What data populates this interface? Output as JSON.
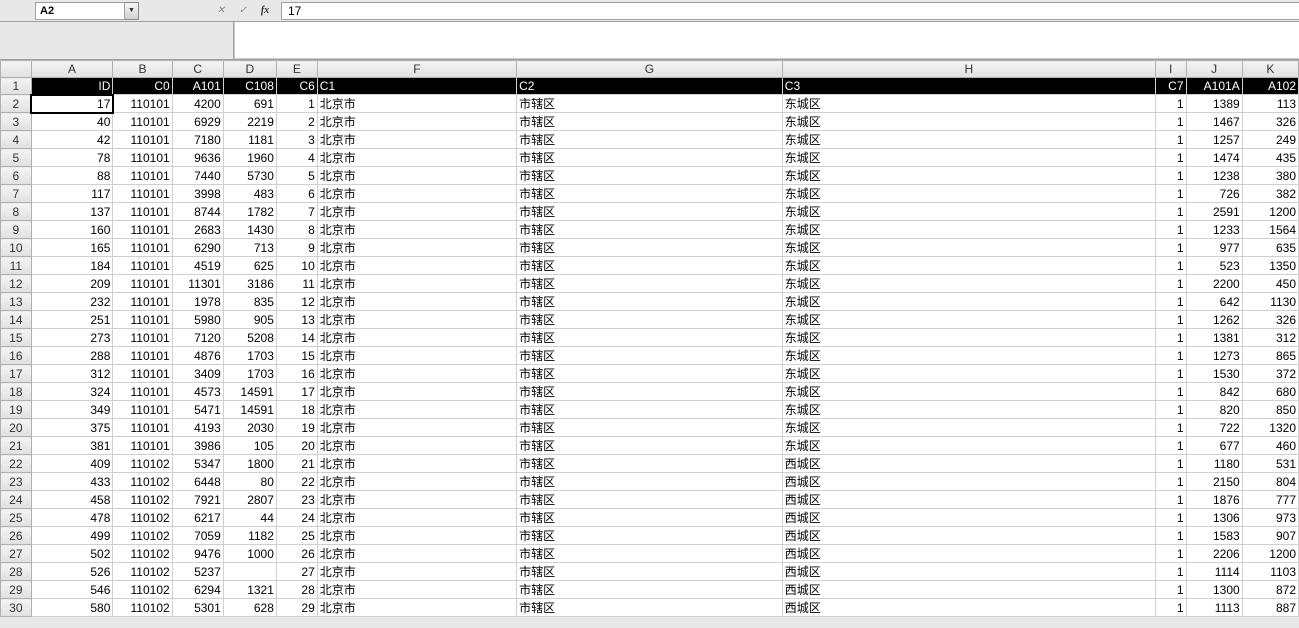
{
  "nameBox": "A2",
  "formula": "17",
  "columns": [
    "A",
    "B",
    "C",
    "D",
    "E",
    "F",
    "G",
    "H",
    "I",
    "J",
    "K"
  ],
  "headerRow": {
    "A": "ID",
    "B": "C0",
    "C": "A101",
    "D": "C108",
    "E": "C6",
    "F": "C1",
    "G": "C2",
    "H": "C3",
    "I": "C7",
    "J": "A101A",
    "K": "A102"
  },
  "rows": [
    {
      "n": 2,
      "A": "17",
      "B": "110101",
      "C": "4200",
      "D": "691",
      "E": "1",
      "F": "北京市",
      "G": "市辖区",
      "H": "东城区",
      "I": "1",
      "J": "1389",
      "K": "113"
    },
    {
      "n": 3,
      "A": "40",
      "B": "110101",
      "C": "6929",
      "D": "2219",
      "E": "2",
      "F": "北京市",
      "G": "市辖区",
      "H": "东城区",
      "I": "1",
      "J": "1467",
      "K": "326"
    },
    {
      "n": 4,
      "A": "42",
      "B": "110101",
      "C": "7180",
      "D": "1181",
      "E": "3",
      "F": "北京市",
      "G": "市辖区",
      "H": "东城区",
      "I": "1",
      "J": "1257",
      "K": "249"
    },
    {
      "n": 5,
      "A": "78",
      "B": "110101",
      "C": "9636",
      "D": "1960",
      "E": "4",
      "F": "北京市",
      "G": "市辖区",
      "H": "东城区",
      "I": "1",
      "J": "1474",
      "K": "435"
    },
    {
      "n": 6,
      "A": "88",
      "B": "110101",
      "C": "7440",
      "D": "5730",
      "E": "5",
      "F": "北京市",
      "G": "市辖区",
      "H": "东城区",
      "I": "1",
      "J": "1238",
      "K": "380"
    },
    {
      "n": 7,
      "A": "117",
      "B": "110101",
      "C": "3998",
      "D": "483",
      "E": "6",
      "F": "北京市",
      "G": "市辖区",
      "H": "东城区",
      "I": "1",
      "J": "726",
      "K": "382"
    },
    {
      "n": 8,
      "A": "137",
      "B": "110101",
      "C": "8744",
      "D": "1782",
      "E": "7",
      "F": "北京市",
      "G": "市辖区",
      "H": "东城区",
      "I": "1",
      "J": "2591",
      "K": "1200"
    },
    {
      "n": 9,
      "A": "160",
      "B": "110101",
      "C": "2683",
      "D": "1430",
      "E": "8",
      "F": "北京市",
      "G": "市辖区",
      "H": "东城区",
      "I": "1",
      "J": "1233",
      "K": "1564"
    },
    {
      "n": 10,
      "A": "165",
      "B": "110101",
      "C": "6290",
      "D": "713",
      "E": "9",
      "F": "北京市",
      "G": "市辖区",
      "H": "东城区",
      "I": "1",
      "J": "977",
      "K": "635"
    },
    {
      "n": 11,
      "A": "184",
      "B": "110101",
      "C": "4519",
      "D": "625",
      "E": "10",
      "F": "北京市",
      "G": "市辖区",
      "H": "东城区",
      "I": "1",
      "J": "523",
      "K": "1350"
    },
    {
      "n": 12,
      "A": "209",
      "B": "110101",
      "C": "11301",
      "D": "3186",
      "E": "11",
      "F": "北京市",
      "G": "市辖区",
      "H": "东城区",
      "I": "1",
      "J": "2200",
      "K": "450"
    },
    {
      "n": 13,
      "A": "232",
      "B": "110101",
      "C": "1978",
      "D": "835",
      "E": "12",
      "F": "北京市",
      "G": "市辖区",
      "H": "东城区",
      "I": "1",
      "J": "642",
      "K": "1130"
    },
    {
      "n": 14,
      "A": "251",
      "B": "110101",
      "C": "5980",
      "D": "905",
      "E": "13",
      "F": "北京市",
      "G": "市辖区",
      "H": "东城区",
      "I": "1",
      "J": "1262",
      "K": "326"
    },
    {
      "n": 15,
      "A": "273",
      "B": "110101",
      "C": "7120",
      "D": "5208",
      "E": "14",
      "F": "北京市",
      "G": "市辖区",
      "H": "东城区",
      "I": "1",
      "J": "1381",
      "K": "312"
    },
    {
      "n": 16,
      "A": "288",
      "B": "110101",
      "C": "4876",
      "D": "1703",
      "E": "15",
      "F": "北京市",
      "G": "市辖区",
      "H": "东城区",
      "I": "1",
      "J": "1273",
      "K": "865"
    },
    {
      "n": 17,
      "A": "312",
      "B": "110101",
      "C": "3409",
      "D": "1703",
      "E": "16",
      "F": "北京市",
      "G": "市辖区",
      "H": "东城区",
      "I": "1",
      "J": "1530",
      "K": "372"
    },
    {
      "n": 18,
      "A": "324",
      "B": "110101",
      "C": "4573",
      "D": "14591",
      "E": "17",
      "F": "北京市",
      "G": "市辖区",
      "H": "东城区",
      "I": "1",
      "J": "842",
      "K": "680"
    },
    {
      "n": 19,
      "A": "349",
      "B": "110101",
      "C": "5471",
      "D": "14591",
      "E": "18",
      "F": "北京市",
      "G": "市辖区",
      "H": "东城区",
      "I": "1",
      "J": "820",
      "K": "850"
    },
    {
      "n": 20,
      "A": "375",
      "B": "110101",
      "C": "4193",
      "D": "2030",
      "E": "19",
      "F": "北京市",
      "G": "市辖区",
      "H": "东城区",
      "I": "1",
      "J": "722",
      "K": "1320"
    },
    {
      "n": 21,
      "A": "381",
      "B": "110101",
      "C": "3986",
      "D": "105",
      "E": "20",
      "F": "北京市",
      "G": "市辖区",
      "H": "东城区",
      "I": "1",
      "J": "677",
      "K": "460"
    },
    {
      "n": 22,
      "A": "409",
      "B": "110102",
      "C": "5347",
      "D": "1800",
      "E": "21",
      "F": "北京市",
      "G": "市辖区",
      "H": "西城区",
      "I": "1",
      "J": "1180",
      "K": "531"
    },
    {
      "n": 23,
      "A": "433",
      "B": "110102",
      "C": "6448",
      "D": "80",
      "E": "22",
      "F": "北京市",
      "G": "市辖区",
      "H": "西城区",
      "I": "1",
      "J": "2150",
      "K": "804"
    },
    {
      "n": 24,
      "A": "458",
      "B": "110102",
      "C": "7921",
      "D": "2807",
      "E": "23",
      "F": "北京市",
      "G": "市辖区",
      "H": "西城区",
      "I": "1",
      "J": "1876",
      "K": "777"
    },
    {
      "n": 25,
      "A": "478",
      "B": "110102",
      "C": "6217",
      "D": "44",
      "E": "24",
      "F": "北京市",
      "G": "市辖区",
      "H": "西城区",
      "I": "1",
      "J": "1306",
      "K": "973"
    },
    {
      "n": 26,
      "A": "499",
      "B": "110102",
      "C": "7059",
      "D": "1182",
      "E": "25",
      "F": "北京市",
      "G": "市辖区",
      "H": "西城区",
      "I": "1",
      "J": "1583",
      "K": "907"
    },
    {
      "n": 27,
      "A": "502",
      "B": "110102",
      "C": "9476",
      "D": "1000",
      "E": "26",
      "F": "北京市",
      "G": "市辖区",
      "H": "西城区",
      "I": "1",
      "J": "2206",
      "K": "1200"
    },
    {
      "n": 28,
      "A": "526",
      "B": "110102",
      "C": "5237",
      "D": "",
      "E": "27",
      "F": "北京市",
      "G": "市辖区",
      "H": "西城区",
      "I": "1",
      "J": "1114",
      "K": "1103"
    },
    {
      "n": 29,
      "A": "546",
      "B": "110102",
      "C": "6294",
      "D": "1321",
      "E": "28",
      "F": "北京市",
      "G": "市辖区",
      "H": "西城区",
      "I": "1",
      "J": "1300",
      "K": "872"
    },
    {
      "n": 30,
      "A": "580",
      "B": "110102",
      "C": "5301",
      "D": "628",
      "E": "29",
      "F": "北京市",
      "G": "市辖区",
      "H": "西城区",
      "I": "1",
      "J": "1113",
      "K": "887"
    }
  ],
  "activeCell": {
    "row": 2,
    "col": "A"
  },
  "textCols": [
    "F",
    "G",
    "H"
  ]
}
